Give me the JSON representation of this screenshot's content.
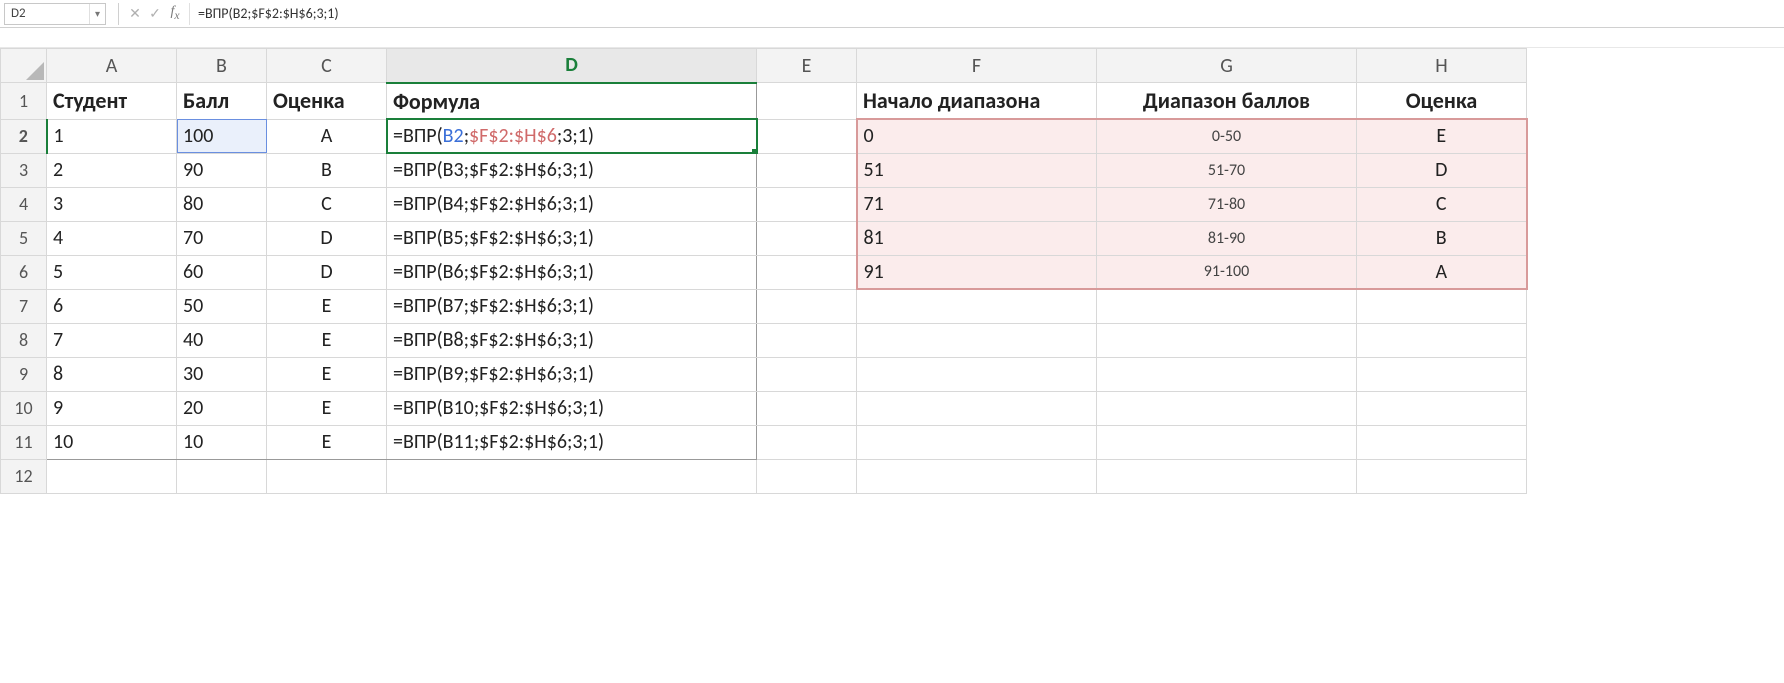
{
  "namebox": "D2",
  "formula_bar": "=ВПР(B2;$F$2:$H$6;3;1)",
  "columns": [
    "A",
    "B",
    "C",
    "D",
    "E",
    "F",
    "G",
    "H"
  ],
  "d2_formula_tokens": {
    "pre": "=ВПР(",
    "arg_blue": "B2",
    "sep1": ";",
    "arg_red": "$F$2:$H$6",
    "tail": ";3;1)"
  },
  "headers": {
    "A": "Студент",
    "B": "Балл",
    "C": "Оценка",
    "D": "Формула",
    "F": "Начало диапазона",
    "G": "Диапазон баллов",
    "H": "Оценка"
  },
  "students": [
    {
      "n": "1",
      "score": "100",
      "grade": "A",
      "formula": "=ВПР(B2;$F$2:$H$6;3;1)"
    },
    {
      "n": "2",
      "score": "90",
      "grade": "B",
      "formula": "=ВПР(B3;$F$2:$H$6;3;1)"
    },
    {
      "n": "3",
      "score": "80",
      "grade": "C",
      "formula": "=ВПР(B4;$F$2:$H$6;3;1)"
    },
    {
      "n": "4",
      "score": "70",
      "grade": "D",
      "formula": "=ВПР(B5;$F$2:$H$6;3;1)"
    },
    {
      "n": "5",
      "score": "60",
      "grade": "D",
      "formula": "=ВПР(B6;$F$2:$H$6;3;1)"
    },
    {
      "n": "6",
      "score": "50",
      "grade": "E",
      "formula": "=ВПР(B7;$F$2:$H$6;3;1)"
    },
    {
      "n": "7",
      "score": "40",
      "grade": "E",
      "formula": "=ВПР(B8;$F$2:$H$6;3;1)"
    },
    {
      "n": "8",
      "score": "30",
      "grade": "E",
      "formula": "=ВПР(B9;$F$2:$H$6;3;1)"
    },
    {
      "n": "9",
      "score": "20",
      "grade": "E",
      "formula": "=ВПР(B10;$F$2:$H$6;3;1)"
    },
    {
      "n": "10",
      "score": "10",
      "grade": "E",
      "formula": "=ВПР(B11;$F$2:$H$6;3;1)"
    }
  ],
  "lookup": [
    {
      "start": "0",
      "range": "0-50",
      "grade": "E"
    },
    {
      "start": "51",
      "range": "51-70",
      "grade": "D"
    },
    {
      "start": "71",
      "range": "71-80",
      "grade": "C"
    },
    {
      "start": "81",
      "range": "81-90",
      "grade": "B"
    },
    {
      "start": "91",
      "range": "91-100",
      "grade": "A"
    }
  ],
  "visible_rows": 12
}
